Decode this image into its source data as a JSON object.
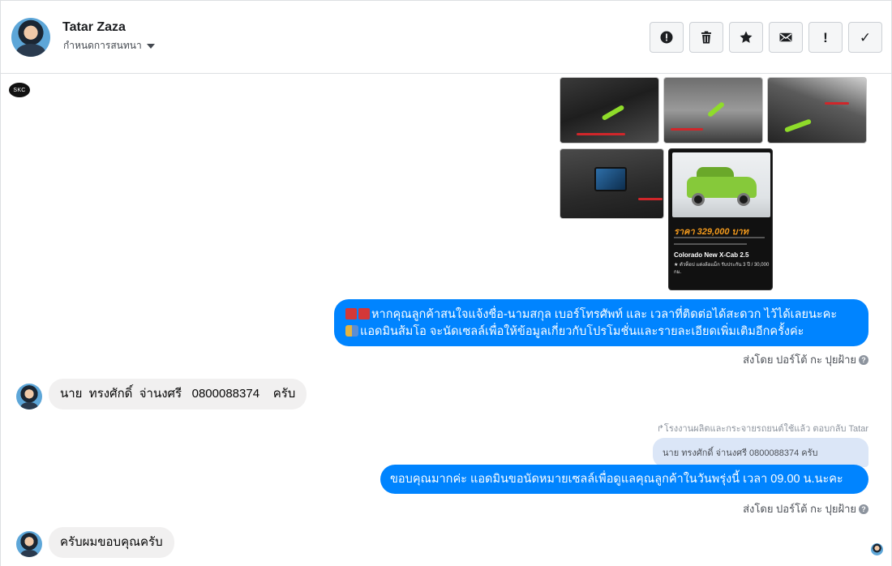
{
  "header": {
    "contact_name": "Tatar Zaza",
    "settings_label": "กำหนดการสนทนา",
    "actions": [
      {
        "name": "spam-button",
        "icon": "alert-circle-icon"
      },
      {
        "name": "delete-button",
        "icon": "trash-icon"
      },
      {
        "name": "star-button",
        "icon": "star-icon"
      },
      {
        "name": "mark-unread-button",
        "icon": "envelope-icon"
      },
      {
        "name": "follow-up-button",
        "icon": "exclamation-icon",
        "glyph": "!"
      },
      {
        "name": "mark-done-button",
        "icon": "checkmark-icon",
        "glyph": "✓"
      }
    ]
  },
  "page_logo": {
    "text": "SKC"
  },
  "photo_card": {
    "price": "ราคา 329,000 บาท",
    "model": "Colorado New X-Cab 2.5",
    "spec_line": "★ ตัวท็อป แต่งล้อแม็ก รับประกัน 3 ปี / 30,000 กม."
  },
  "messages": {
    "outgoing_1": "หากคุณลูกค้าสนใจแจ้งชื่อ-นามสกุล เบอร์โทรศัพท์ และ เวลาที่ติดต่อได้สะดวก ไว้ได้เลยนะคะ",
    "outgoing_1_line2": "แอดมินส้มโอ จะนัดเซลล์เพื่อให้ข้อมูลเกี่ยวกับโปรโมชั่นและรายละเอียดเพิ่มเติมอีกครั้งค่ะ",
    "sent_by_1": "ส่งโดย ปอร์โต้ กะ ปุยฝ้าย",
    "incoming_1": "นาย  ทรงศักดิ์  จ่านงศรี   0800088374    ครับ",
    "reply_note": "↱โรงงานผลิตและกระจายรถยนต์ใช้แล้ว ตอบกลับ Tatar",
    "quoted_text": "นาย ทรงศักดิ์ จ่านงศรี 0800088374 ครับ",
    "outgoing_2": "ขอบคุณมากค่ะ แอดมินขอนัดหมายเซลล์เพื่อดูแลคุณลูกค้าในวันพรุ่งนี้ เวลา 09.00 น.นะคะ",
    "sent_by_2": "ส่งโดย ปอร์โต้ กะ ปุยฝ้าย",
    "incoming_2": "ครับผมขอบคุณครับ"
  },
  "colors": {
    "outgoing_bubble": "#0084ff",
    "incoming_bubble": "#f1f0f0",
    "quoted_bubble": "#dbe6f7",
    "accent_green": "#8fdc2a",
    "price_orange": "#f39a1d"
  }
}
